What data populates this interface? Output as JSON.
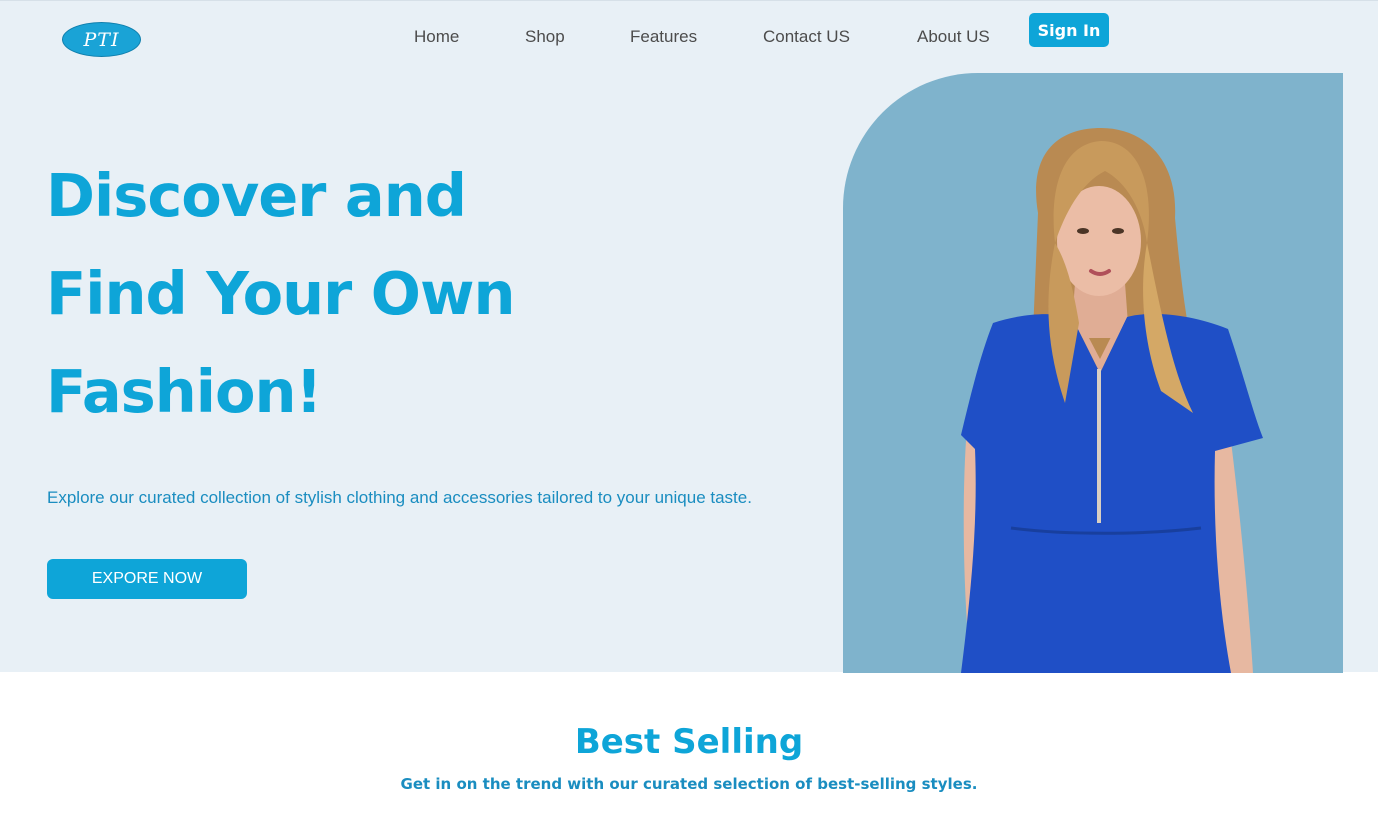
{
  "brand": {
    "logo_text": "PTI",
    "accent_color": "#0ea5d8"
  },
  "nav": {
    "items": [
      {
        "label": "Home"
      },
      {
        "label": "Shop"
      },
      {
        "label": "Features"
      },
      {
        "label": "Contact US"
      },
      {
        "label": "About US"
      }
    ],
    "signin_label": "Sign In"
  },
  "hero": {
    "title_lines": [
      "Discover and",
      "Find Your Own",
      "Fashion!"
    ],
    "subtitle": "Explore our curated collection of stylish clothing and accessories tailored to your unique taste.",
    "cta_label": "EXPORE NOW",
    "image": "model-in-blue-scrubs"
  },
  "best_selling": {
    "title": "Best Selling",
    "subtitle": "Get in on the trend with our curated selection of best-selling styles."
  }
}
